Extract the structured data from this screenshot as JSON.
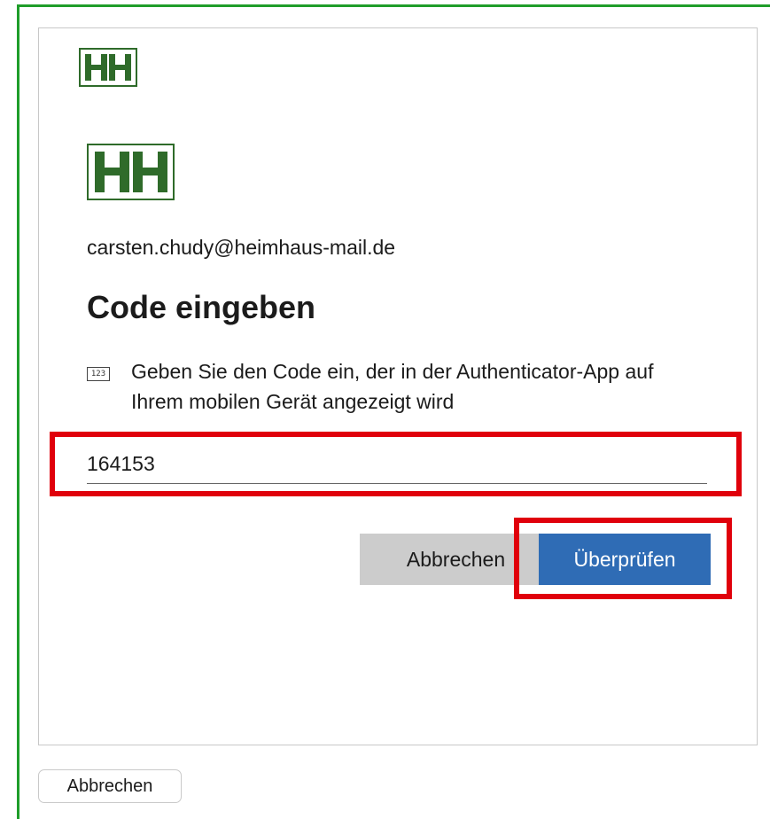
{
  "brand": {
    "logo_icon": "hh-logo-icon",
    "logo_color": "#2f6b2a"
  },
  "dialog": {
    "email": "carsten.chudy@heimhaus-mail.de",
    "title": "Code eingeben",
    "hint_icon": "numeric-code-icon",
    "hint_icon_text": "123",
    "hint_text": "Geben Sie den Code ein, der in der Authenticator-App auf Ihrem mobilen Gerät angezeigt wird",
    "code_value": "164153",
    "cancel_label": "Abbrechen",
    "verify_label": "Überprüfen",
    "verify_color": "#2f6cb5"
  },
  "footer": {
    "cancel_label": "Abbrechen"
  },
  "annotations": {
    "frame_color": "#1f9d2a",
    "highlight_color": "#e0000b"
  }
}
